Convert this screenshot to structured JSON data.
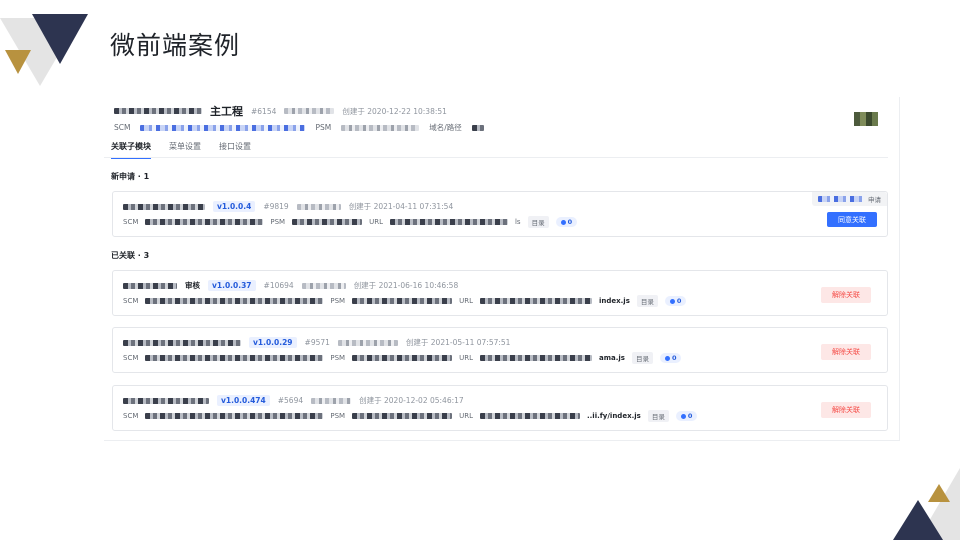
{
  "slide": {
    "title": "微前端案例"
  },
  "header": {
    "project_suffix": "主工程",
    "project_id": "#6154",
    "created": "创建于 2020-12-22 10:38:51",
    "scm_label": "SCM",
    "psm_label": "PSM",
    "domain_label": "域名/路径"
  },
  "tabs": [
    {
      "label": "关联子模块",
      "active": true
    },
    {
      "label": "菜单设置",
      "active": false
    },
    {
      "label": "接口设置",
      "active": false
    }
  ],
  "pending": {
    "heading": "新申请 · 1",
    "items": [
      {
        "version": "v1.0.0.4",
        "id": "#9819",
        "created": "创建于 2021-04-11 07:31:54",
        "scm_label": "SCM",
        "psm_label": "PSM",
        "url_label": "URL",
        "url_tail": "ls",
        "dir_tag": "目录",
        "count": "0",
        "request_label": "申请",
        "action_label": "同意关联"
      }
    ]
  },
  "linked": {
    "heading": "已关联 · 3",
    "items": [
      {
        "name_suffix": "审核",
        "version": "v1.0.0.37",
        "id": "#10694",
        "created": "创建于 2021-06-16 10:46:58",
        "scm_label": "SCM",
        "psm_label": "PSM",
        "url_label": "URL",
        "url_tail": "index.js",
        "dir_tag": "目录",
        "count": "0",
        "action_label": "解除关联"
      },
      {
        "name_suffix": "",
        "version": "v1.0.0.29",
        "id": "#9571",
        "created": "创建于 2021-05-11 07:57:51",
        "scm_label": "SCM",
        "psm_label": "PSM",
        "url_label": "URL",
        "url_tail": "ama.js",
        "dir_tag": "目录",
        "count": "0",
        "action_label": "解除关联"
      },
      {
        "name_suffix": "",
        "version": "v1.0.0.474",
        "id": "#5694",
        "created": "创建于 2020-12-02 05:46:17",
        "scm_label": "SCM",
        "psm_label": "PSM",
        "url_label": "URL",
        "url_tail": "..ii.fy/index.js",
        "dir_tag": "目录",
        "count": "0",
        "action_label": "解除关联"
      }
    ]
  },
  "colors": {
    "accent": "#3370ff",
    "danger": "#f54a45",
    "navy": "#2d3450",
    "gold": "#b8923f"
  }
}
